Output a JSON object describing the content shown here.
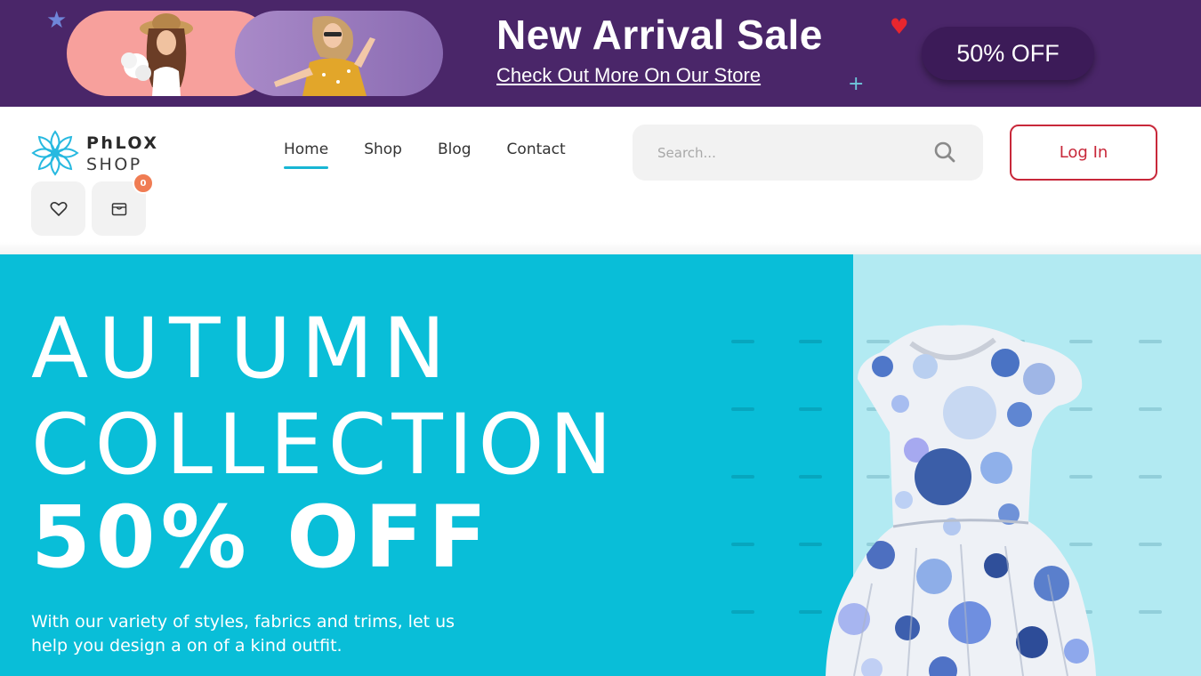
{
  "promo": {
    "title": "New Arrival Sale",
    "link": "Check Out More On Our Store",
    "discount_button": "50% OFF"
  },
  "header": {
    "logo": {
      "line1": "PhLOX",
      "line2": "SHOP"
    },
    "nav": [
      {
        "label": "Home",
        "active": true
      },
      {
        "label": "Shop",
        "active": false
      },
      {
        "label": "Blog",
        "active": false
      },
      {
        "label": "Contact",
        "active": false
      }
    ],
    "search": {
      "placeholder": "Search..."
    },
    "login_label": "Log In",
    "cart_count": "0"
  },
  "hero": {
    "line1": "AUTUMN",
    "line2": "COLLECTION",
    "line3": "50% OFF",
    "subtitle": "With our variety of styles, fabrics and trims, let us help you design a on of a kind outfit."
  },
  "icons": [
    "star-icon",
    "plus-icon",
    "heart-icon",
    "search-icon",
    "wishlist-heart-icon",
    "cart-bag-icon"
  ],
  "colors": {
    "promo_bg": "#4a2669",
    "hero_bg": "#09bed8",
    "hero_side": "#b2eaf2",
    "accent": "#18b6d4",
    "login": "#c8283a",
    "badge": "#f07c53"
  }
}
